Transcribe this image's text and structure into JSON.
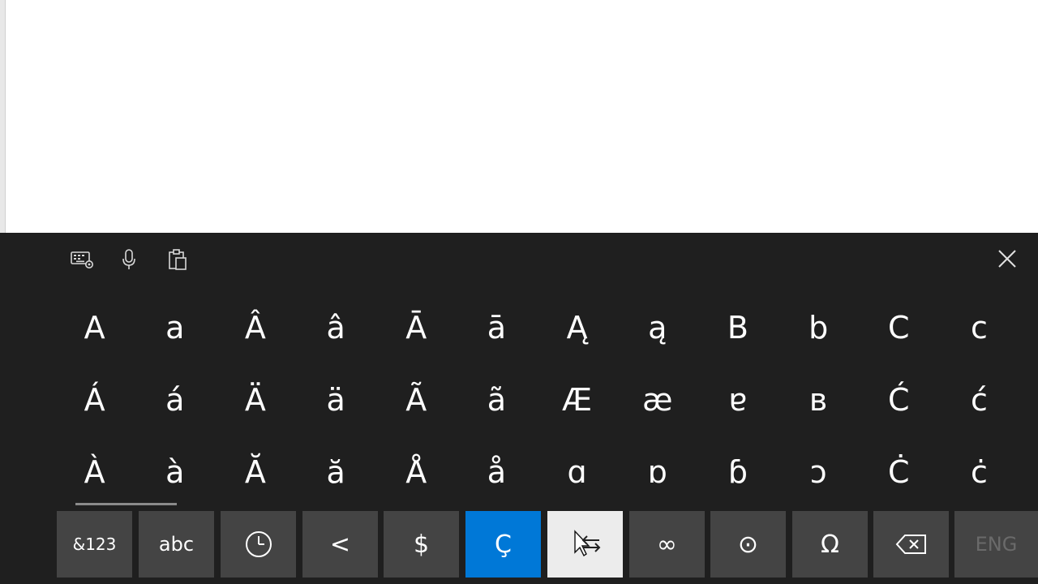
{
  "keyboard": {
    "toolbar": {
      "icons": [
        "keyboard-settings-icon",
        "microphone-icon",
        "clipboard-icon"
      ],
      "close": "close-icon"
    },
    "rows": [
      [
        "A",
        "a",
        "Â",
        "â",
        "Ā",
        "ā",
        "Ą",
        "ą",
        "B",
        "b",
        "C",
        "c"
      ],
      [
        "Á",
        "á",
        "Ä",
        "ä",
        "Ã",
        "ã",
        "Æ",
        "æ",
        "ɐ",
        "в",
        "Ć",
        "ć"
      ],
      [
        "À",
        "à",
        "Ă",
        "ă",
        "Å",
        "å",
        "ɑ",
        "ɒ",
        "ɓ",
        "ɔ",
        "Ċ",
        "ċ"
      ]
    ],
    "bottom_row": {
      "numbers_label": "&123",
      "abc_label": "abc",
      "recent_icon": "clock-icon",
      "less_than": "<",
      "dollar": "$",
      "c_cedilla": "Ç",
      "swap_icon": "swap-arrows-icon",
      "infinity": "∞",
      "circle_dot": "⊙",
      "omega": "Ω",
      "backspace_icon": "backspace-icon",
      "language": "ENG"
    },
    "colors": {
      "background": "#1f1f1f",
      "key": "#444444",
      "accent": "#0078d7",
      "pressed": "#ececec"
    }
  }
}
